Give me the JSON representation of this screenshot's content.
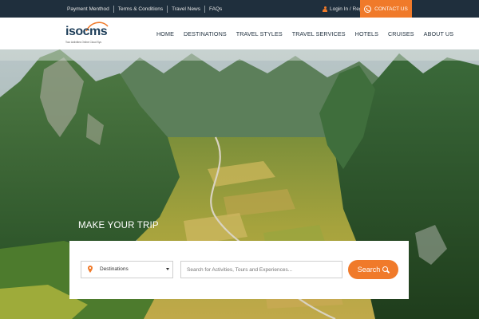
{
  "topbar": {
    "links": [
      "Payment Menthod",
      "Terms & Conditions",
      "Travel News",
      "FAQs"
    ],
    "login_label": "Login In / Register",
    "contact_label": "CONTACT US"
  },
  "header": {
    "logo_text": "isocms",
    "logo_tagline": "Tour Activities Online Cloud Sys",
    "nav": [
      "HOME",
      "DESTINATIONS",
      "TRAVEL STYLES",
      "TRAVEL SERVICES",
      "HOTELS",
      "CRUISES",
      "ABOUT US"
    ]
  },
  "hero": {
    "image_subject": "aerial mountain valley with rice fields",
    "title": "MAKE YOUR TRIP"
  },
  "search": {
    "destination_label": "Destinations",
    "query_placeholder": "Search for Activities, Tours and Experiences...",
    "button_label": "Search"
  },
  "colors": {
    "accent": "#f07a2a",
    "topbar_bg": "#1f2f3d",
    "header_bg": "#ffffff",
    "nav_text": "#1f2f3d"
  }
}
